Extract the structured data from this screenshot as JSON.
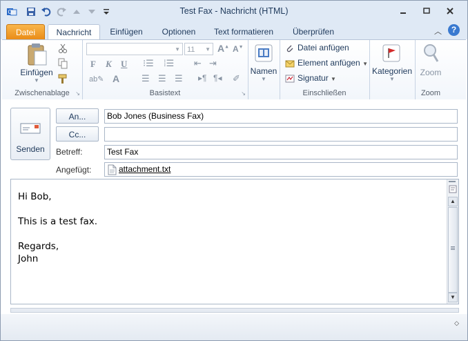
{
  "window": {
    "title": "Test Fax  -  Nachricht (HTML)"
  },
  "tabs": [
    "Datei",
    "Nachricht",
    "Einfügen",
    "Optionen",
    "Text formatieren",
    "Überprüfen"
  ],
  "ribbon": {
    "clipboard": {
      "paste_label": "Einfügen",
      "group_label": "Zwischenablage"
    },
    "basic_text": {
      "font_size": "11",
      "group_label": "Basistext"
    },
    "names": {
      "label": "Namen"
    },
    "include": {
      "attach_file": "Datei anfügen",
      "attach_item": "Element anfügen",
      "signature": "Signatur",
      "group_label": "Einschließen"
    },
    "tags": {
      "categories": "Kategorien"
    },
    "zoom": {
      "button_label": "Zoom",
      "group_label": "Zoom"
    }
  },
  "form": {
    "send_label": "Senden",
    "to_button": "An...",
    "cc_button": "Cc...",
    "to_value": "Bob Jones (Business Fax)",
    "cc_value": "",
    "subject_label": "Betreff:",
    "subject_value": "Test Fax",
    "attached_label": "Angefügt:",
    "attachment_name": "attachment.txt"
  },
  "body": {
    "lines": [
      "Hi Bob,",
      "This is a test fax.",
      "Regards,",
      "John"
    ]
  },
  "colors": {
    "file_tab": "#f0a030",
    "help": "#3a7ad0",
    "accent_text": "#1e395b"
  }
}
